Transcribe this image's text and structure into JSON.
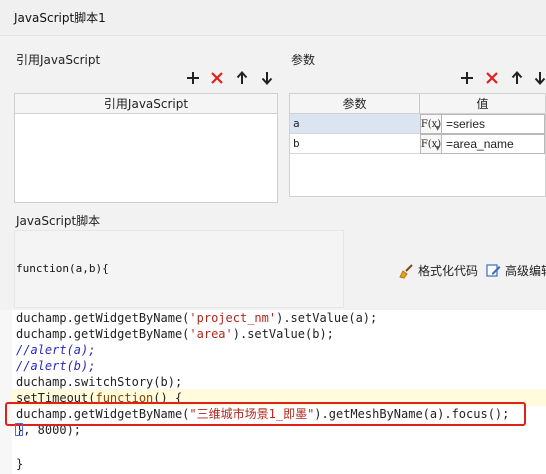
{
  "window": {
    "title": "JavaScript脚本1"
  },
  "references": {
    "label": "引用JavaScript",
    "column_header": "引用JavaScript",
    "rows": []
  },
  "params": {
    "label": "参数",
    "columns": [
      "参数",
      "值"
    ],
    "rows": [
      {
        "name": "a",
        "fx": "F(x)",
        "value": "=series"
      },
      {
        "name": "b",
        "fx": "F(x)",
        "value": "=area_name"
      }
    ]
  },
  "script": {
    "label": "JavaScript脚本",
    "signature": "function(a,b){",
    "format_label": "格式化代码",
    "advanced_label": "高级编辑"
  },
  "code": {
    "l1_a": "duchamp.getWidgetByName(",
    "l1_s": "'project_nm'",
    "l1_b": ").setValue(a);",
    "l2_a": "duchamp.getWidgetByName(",
    "l2_s": "'area'",
    "l2_b": ").setValue(b);",
    "l3": "//alert(a);",
    "l4": "//alert(b);",
    "l5": "duchamp.switchStory(b);",
    "l6_a": "setTimeout(",
    "l6_k": "function",
    "l6_b": "() {",
    "l7_a": "duchamp.getWidgetByName(",
    "l7_s": "\"三维城市场景1_即墨\"",
    "l7_b": ").getMeshByName(a).focus();",
    "l8": "}, 8000);",
    "l9": "}"
  },
  "colors": {
    "highlight_box": "#e0201b",
    "delete_icon": "#e0201b"
  },
  "icons": [
    "add-icon",
    "delete-icon",
    "arrow-up-icon",
    "arrow-down-icon",
    "broom-icon",
    "edit-icon"
  ]
}
